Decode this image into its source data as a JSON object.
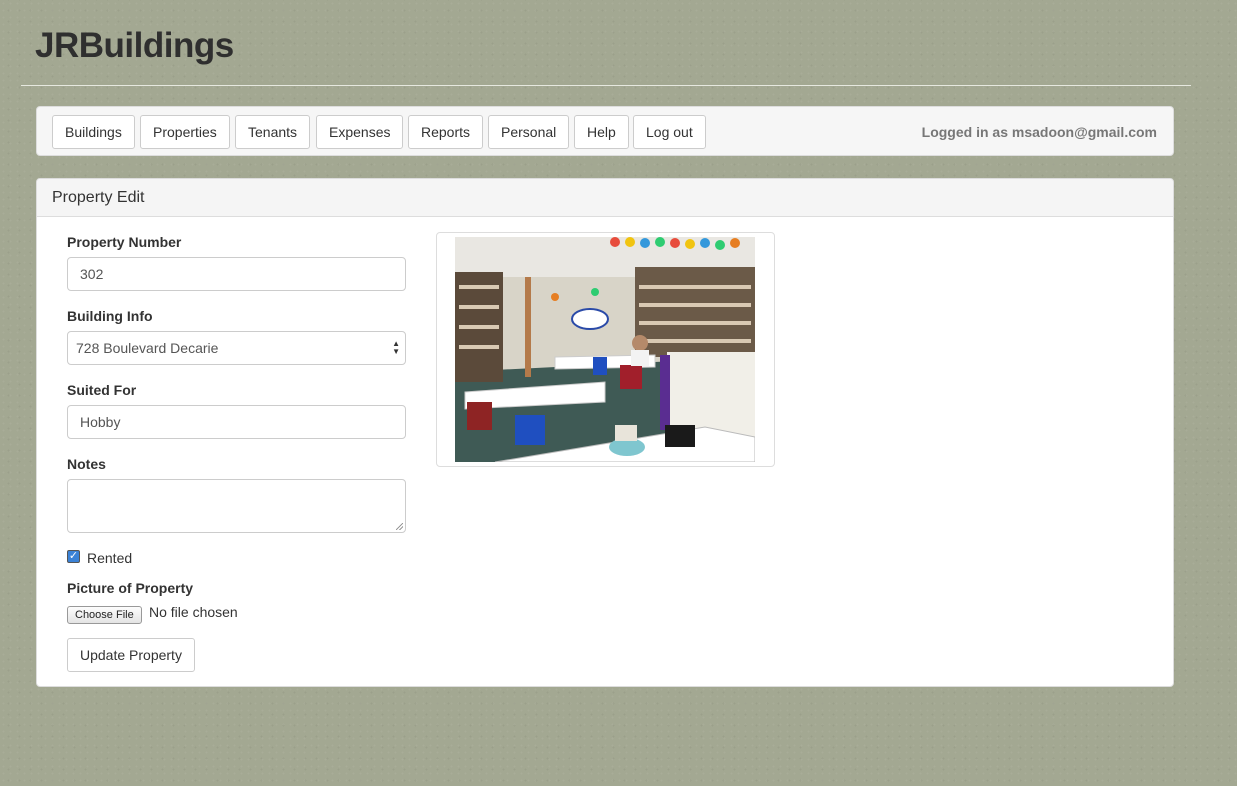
{
  "app": {
    "brand": "JRBuildings"
  },
  "nav": {
    "items": [
      "Buildings",
      "Properties",
      "Tenants",
      "Expenses",
      "Reports",
      "Personal",
      "Help",
      "Log out"
    ],
    "logged_in": "Logged in as msadoon@gmail.com"
  },
  "panel": {
    "title": "Property Edit"
  },
  "form": {
    "property_number": {
      "label": "Property Number",
      "value": "302"
    },
    "building_info": {
      "label": "Building Info",
      "value": "728 Boulevard Decarie"
    },
    "suited_for": {
      "label": "Suited For",
      "value": "Hobby"
    },
    "notes": {
      "label": "Notes",
      "value": ""
    },
    "rented": {
      "label": "Rented",
      "checked": true
    },
    "picture": {
      "label": "Picture of Property",
      "button": "Choose File",
      "status": "No file chosen"
    },
    "submit": "Update Property"
  }
}
